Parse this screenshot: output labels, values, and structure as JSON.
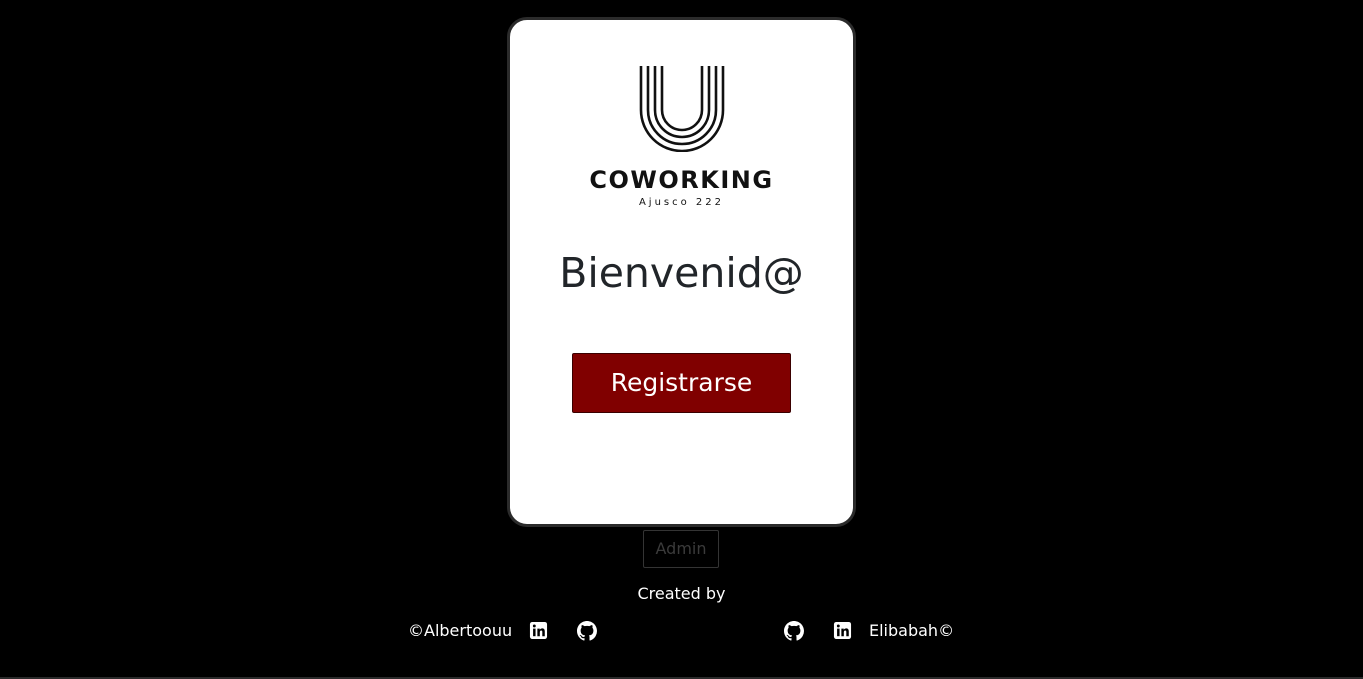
{
  "brand": {
    "name": "COWORKING",
    "subtitle": "Ajusco 222"
  },
  "welcome": {
    "heading": "Bienvenid@"
  },
  "actions": {
    "register_label": "Registrarse",
    "admin_label": "Admin"
  },
  "footer": {
    "created_by": "Created by",
    "left_author": "©Albertoouu",
    "right_author": "Elibabah©",
    "icons": [
      "linkedin-icon",
      "github-icon",
      "github-icon",
      "linkedin-icon"
    ]
  },
  "colors": {
    "background": "#000000",
    "card": "#ffffff",
    "register_button": "#800000",
    "text_dark": "#212529",
    "text_light": "#ffffff"
  }
}
